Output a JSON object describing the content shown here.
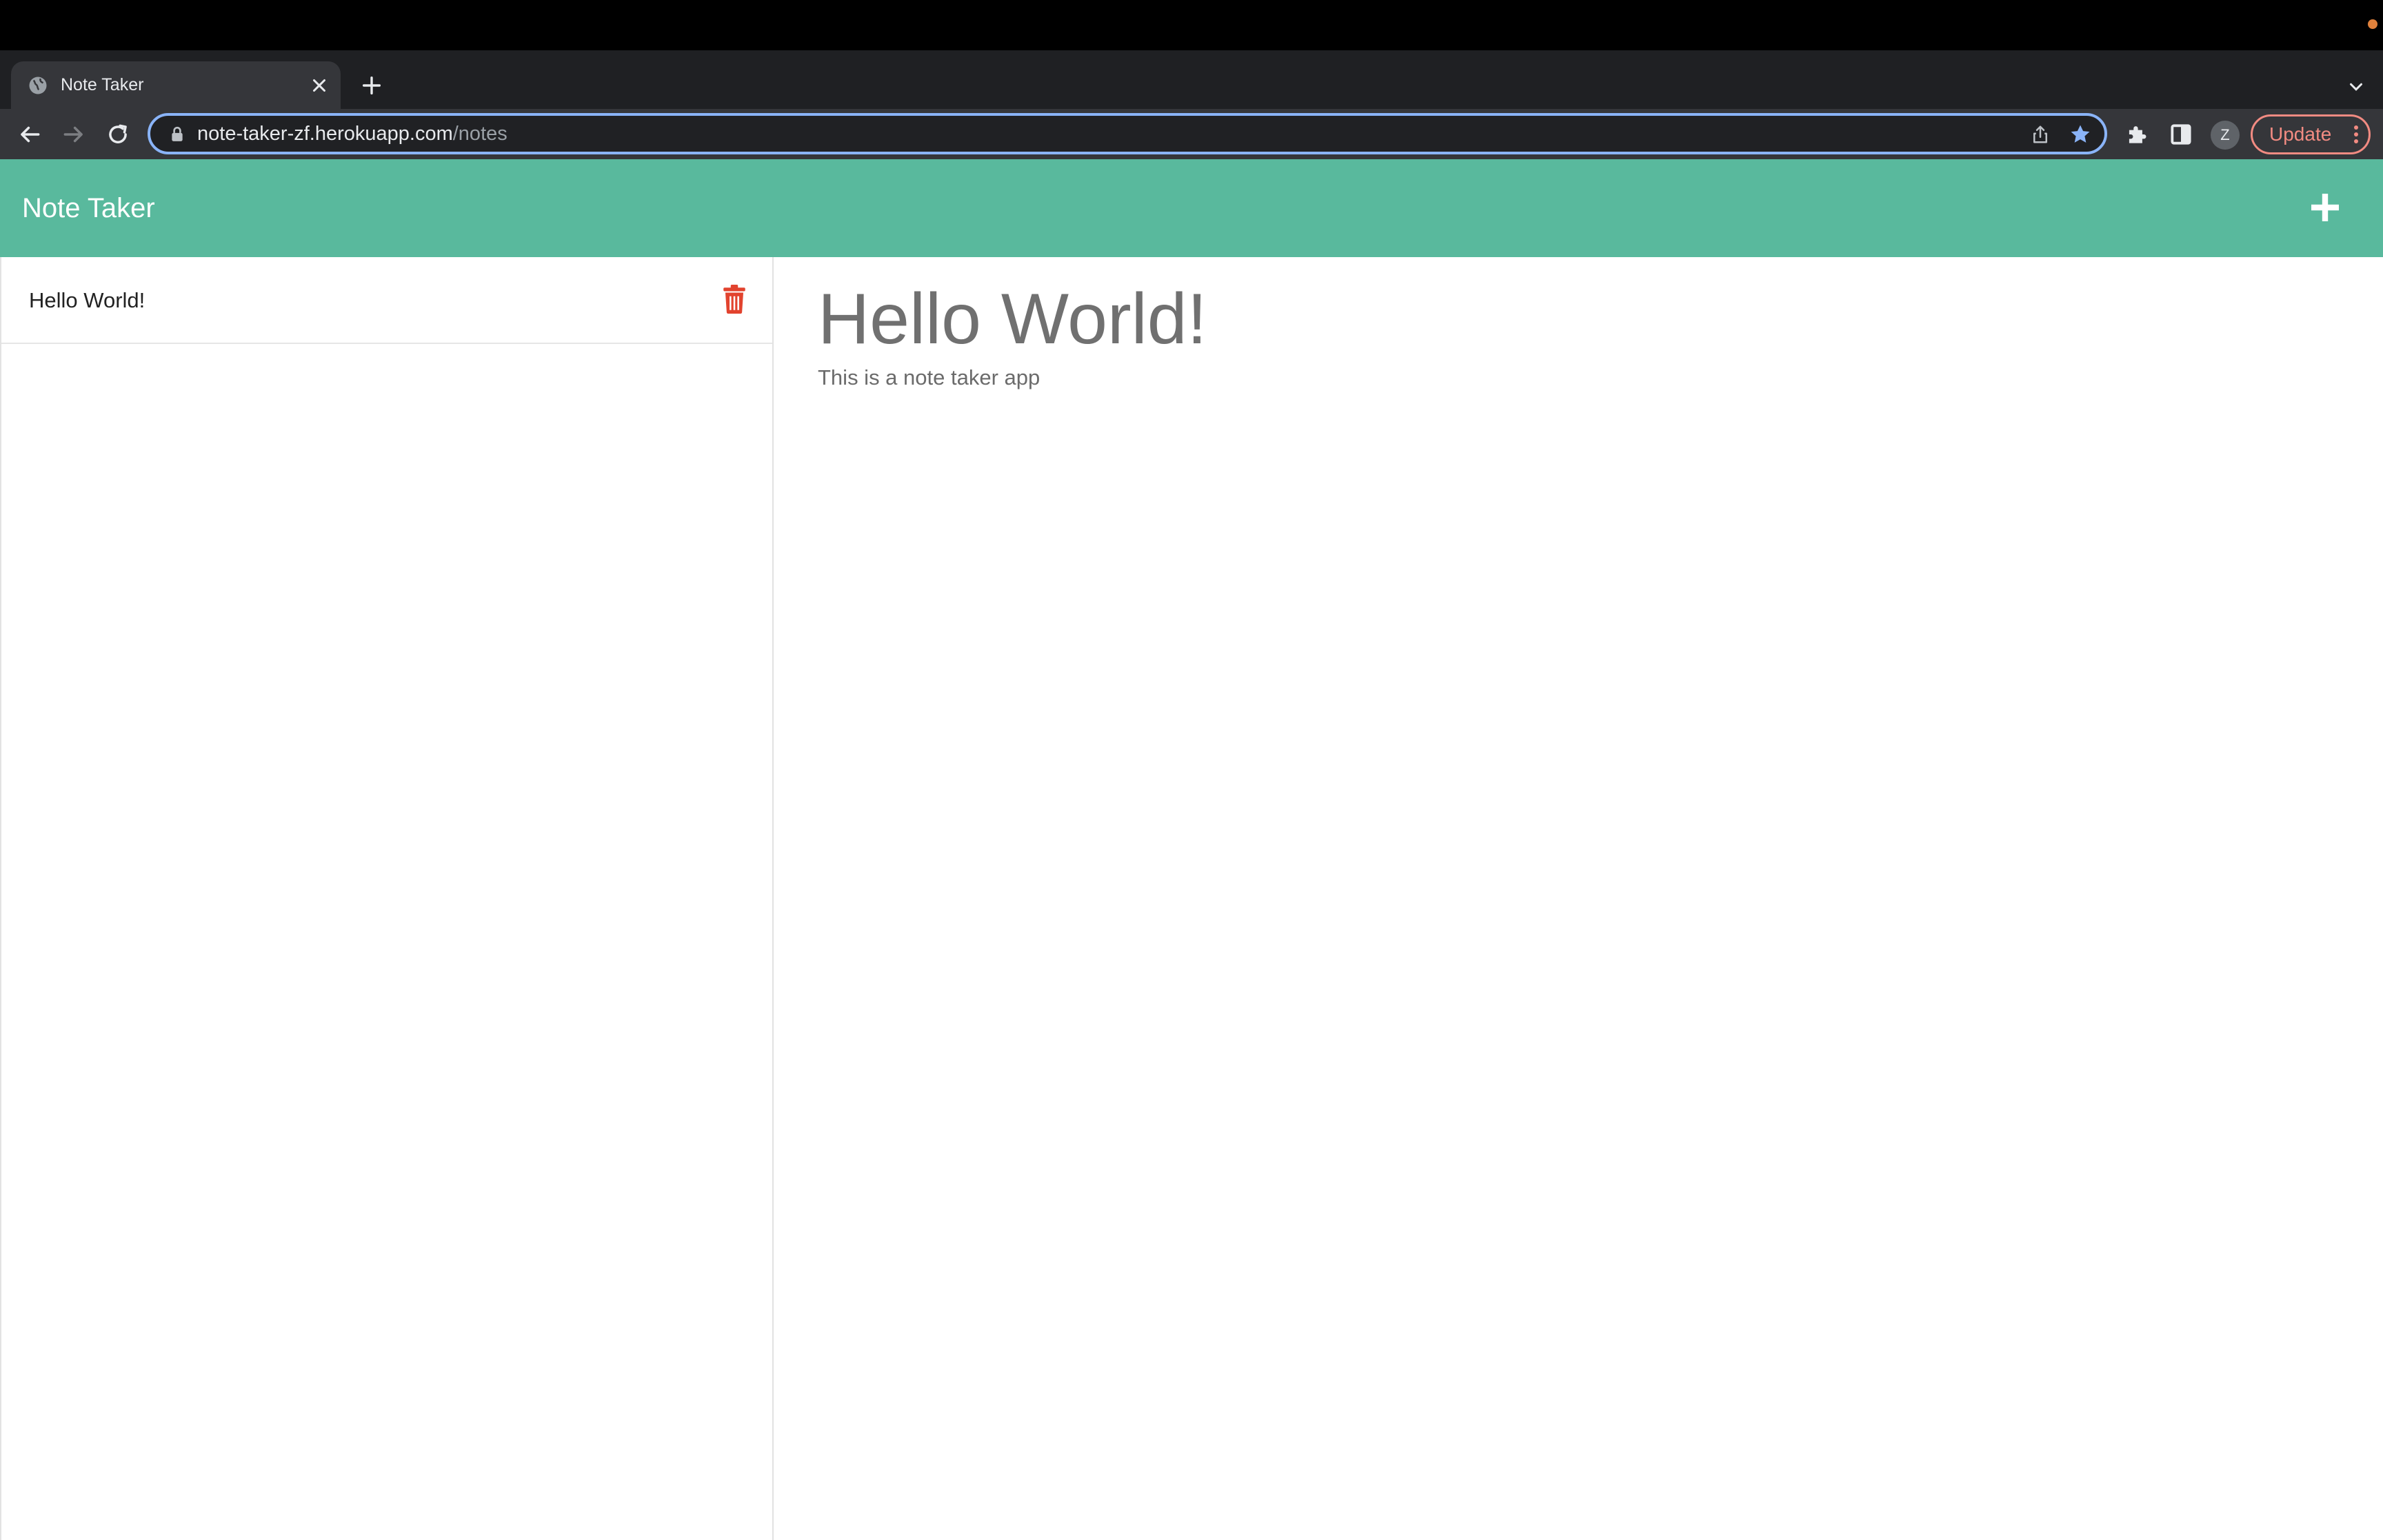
{
  "browser": {
    "tab_title": "Note Taker",
    "url_host": "note-taker-zf.herokuapp.com",
    "url_path": "/notes",
    "profile_initial": "Z",
    "update_label": "Update"
  },
  "app": {
    "brand": "Note Taker"
  },
  "notes": {
    "items": [
      {
        "title": "Hello World!"
      }
    ]
  },
  "active_note": {
    "title": "Hello World!",
    "text": "This is a note taker app"
  },
  "colors": {
    "navbar": "#59b99d",
    "delete_icon": "#e2432e",
    "omnibox_focus": "#8ab4f8"
  }
}
